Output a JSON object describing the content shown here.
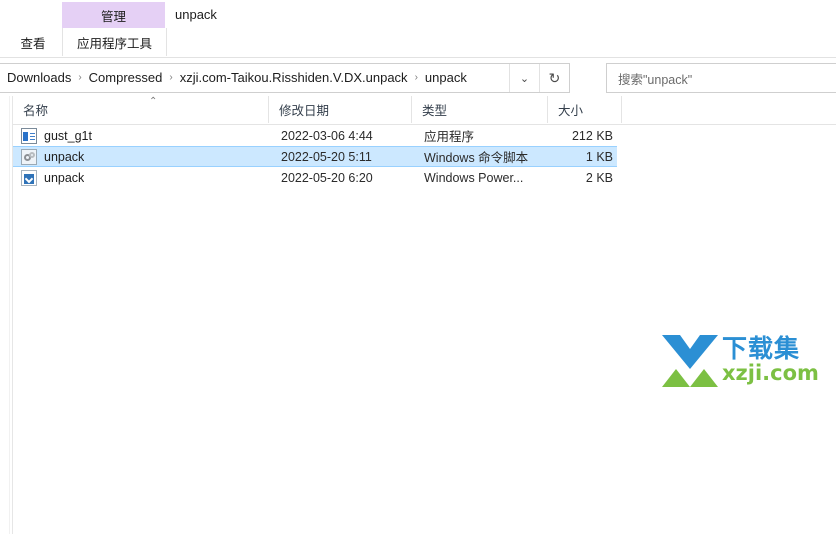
{
  "window": {
    "title": "unpack"
  },
  "ribbon": {
    "contextual_header": "管理",
    "contextual_sub_tab": "应用程序工具",
    "view_tab": "查看",
    "contextual_color": "#e5d0f5"
  },
  "address_bar": {
    "crumbs": [
      "Downloads",
      "Compressed",
      "xzji.com-Taikou.Risshiden.V.DX.unpack",
      "unpack"
    ],
    "separator": "›",
    "dropdown_icon": "chevron-down-icon",
    "refresh_icon": "refresh-icon",
    "refresh_glyph": "↻",
    "dropdown_glyph": "⌄"
  },
  "search": {
    "placeholder": "搜索\"unpack\"",
    "value": ""
  },
  "file_list": {
    "columns": [
      {
        "label": "名称",
        "sorted": true,
        "sort_caret": "⌃"
      },
      {
        "label": "修改日期"
      },
      {
        "label": "类型"
      },
      {
        "label": "大小"
      }
    ],
    "rows": [
      {
        "icon": "application-exe-icon",
        "name": "gust_g1t",
        "date": "2022-03-06 4:44",
        "type": "应用程序",
        "size": "212 KB",
        "selected": false
      },
      {
        "icon": "cmd-script-icon",
        "name": "unpack",
        "date": "2022-05-20 5:11",
        "type": "Windows 命令脚本",
        "size": "1 KB",
        "selected": true
      },
      {
        "icon": "powershell-script-icon",
        "name": "unpack",
        "date": "2022-05-20 6:20",
        "type": "Windows Power...",
        "size": "2 KB",
        "selected": false
      }
    ]
  },
  "watermark": {
    "brand_cn": "下载集",
    "brand_url": "xzji.com",
    "mark_icon": "xzji-arrow-logo",
    "color_blue": "#2b8fd4",
    "color_green": "#7cc043"
  },
  "colors": {
    "selection_fill": "#cce8ff",
    "selection_border": "#99d1ff",
    "header_text": "#35404d"
  }
}
